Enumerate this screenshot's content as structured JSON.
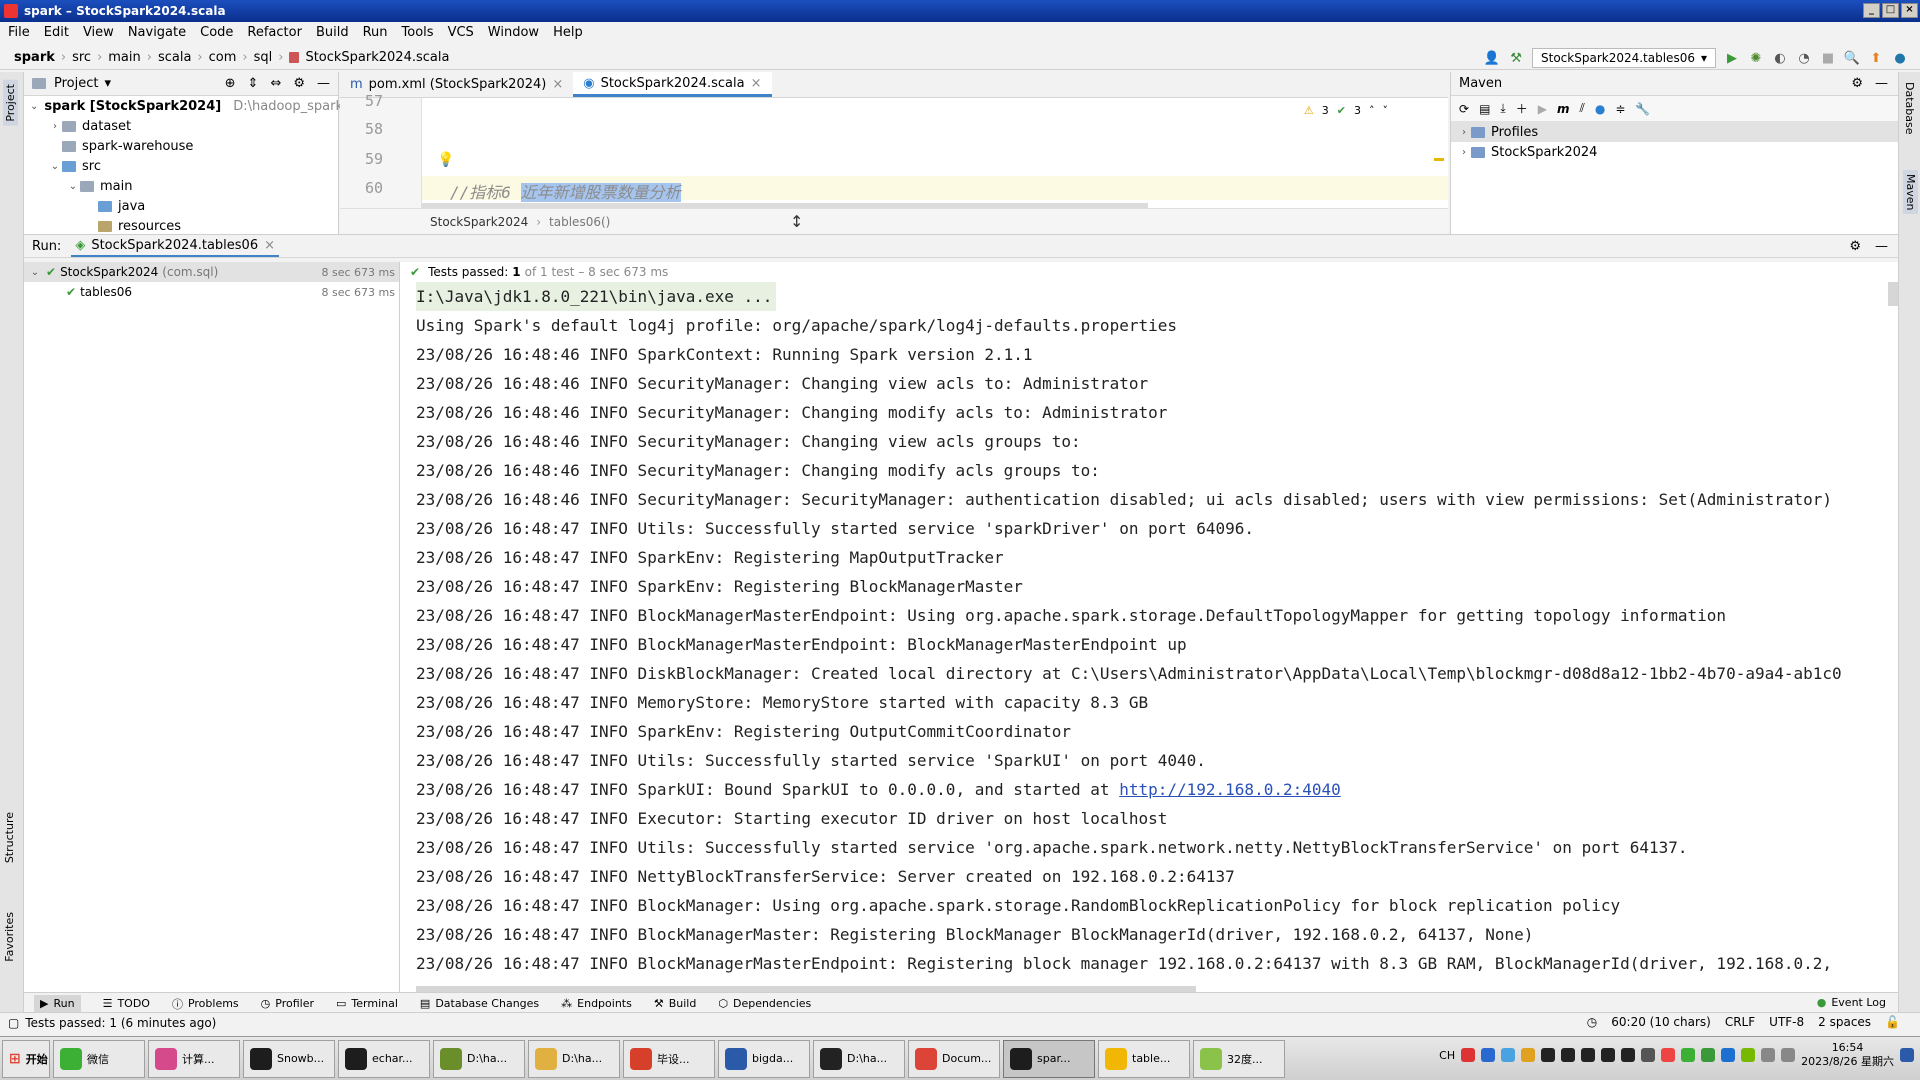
{
  "window": {
    "title": "spark – StockSpark2024.scala"
  },
  "menu": [
    "File",
    "Edit",
    "View",
    "Navigate",
    "Code",
    "Refactor",
    "Build",
    "Run",
    "Tools",
    "VCS",
    "Window",
    "Help"
  ],
  "breadcrumb": [
    "spark",
    "src",
    "main",
    "scala",
    "com",
    "sql",
    "StockSpark2024.scala"
  ],
  "run_config": "StockSpark2024.tables06",
  "project": {
    "header": "Project",
    "tree": [
      {
        "label": "spark [StockSpark2024]",
        "extra": "D:\\hadoop_spark",
        "indent": 0,
        "expanded": true
      },
      {
        "label": "dataset",
        "indent": 1,
        "expanded": false
      },
      {
        "label": "spark-warehouse",
        "indent": 1
      },
      {
        "label": "src",
        "indent": 1,
        "expanded": true
      },
      {
        "label": "main",
        "indent": 2,
        "expanded": true
      },
      {
        "label": "java",
        "indent": 3
      },
      {
        "label": "resources",
        "indent": 3
      }
    ]
  },
  "editor": {
    "tabs": [
      {
        "label": "pom.xml (StockSpark2024)",
        "active": false
      },
      {
        "label": "StockSpark2024.scala",
        "active": true
      }
    ],
    "lines": [
      "57",
      "58",
      "59",
      "60"
    ],
    "comment_prefix": "//指标6",
    "comment_selected": "近年新增股票数量分析",
    "warnings": "3",
    "checks": "3",
    "crumb_class": "StockSpark2024",
    "crumb_method": "tables06()"
  },
  "maven": {
    "title": "Maven",
    "items": [
      "Profiles",
      "StockSpark2024"
    ]
  },
  "run": {
    "label": "Run:",
    "tab": "StockSpark2024.tables06",
    "tree": [
      {
        "label": "StockSpark2024",
        "pkg": "(com.sql)",
        "time": "8 sec 673 ms"
      },
      {
        "label": "tables06",
        "pkg": "",
        "time": "8 sec 673 ms"
      }
    ],
    "status_prefix": "Tests passed:",
    "status_count": "1",
    "status_rest": "of 1 test – 8 sec 673 ms"
  },
  "console": {
    "cmd": "I:\\Java\\jdk1.8.0_221\\bin\\java.exe ...",
    "link_prefix": "23/08/26 16:48:47 INFO SparkUI: Bound SparkUI to 0.0.0.0, and started at ",
    "link": "http://192.168.0.2:4040",
    "lines_before_link": [
      "Using Spark's default log4j profile: org/apache/spark/log4j-defaults.properties",
      "23/08/26 16:48:46 INFO SparkContext: Running Spark version 2.1.1",
      "23/08/26 16:48:46 INFO SecurityManager: Changing view acls to: Administrator",
      "23/08/26 16:48:46 INFO SecurityManager: Changing modify acls to: Administrator",
      "23/08/26 16:48:46 INFO SecurityManager: Changing view acls groups to:",
      "23/08/26 16:48:46 INFO SecurityManager: Changing modify acls groups to:",
      "23/08/26 16:48:46 INFO SecurityManager: SecurityManager: authentication disabled; ui acls disabled; users  with view permissions: Set(Administrator)",
      "23/08/26 16:48:47 INFO Utils: Successfully started service 'sparkDriver' on port 64096.",
      "23/08/26 16:48:47 INFO SparkEnv: Registering MapOutputTracker",
      "23/08/26 16:48:47 INFO SparkEnv: Registering BlockManagerMaster",
      "23/08/26 16:48:47 INFO BlockManagerMasterEndpoint: Using org.apache.spark.storage.DefaultTopologyMapper for getting topology information",
      "23/08/26 16:48:47 INFO BlockManagerMasterEndpoint: BlockManagerMasterEndpoint up",
      "23/08/26 16:48:47 INFO DiskBlockManager: Created local directory at C:\\Users\\Administrator\\AppData\\Local\\Temp\\blockmgr-d08d8a12-1bb2-4b70-a9a4-ab1c0",
      "23/08/26 16:48:47 INFO MemoryStore: MemoryStore started with capacity 8.3 GB",
      "23/08/26 16:48:47 INFO SparkEnv: Registering OutputCommitCoordinator",
      "23/08/26 16:48:47 INFO Utils: Successfully started service 'SparkUI' on port 4040."
    ],
    "lines_after_link": [
      "23/08/26 16:48:47 INFO Executor: Starting executor ID driver on host localhost",
      "23/08/26 16:48:47 INFO Utils: Successfully started service 'org.apache.spark.network.netty.NettyBlockTransferService' on port 64137.",
      "23/08/26 16:48:47 INFO NettyBlockTransferService: Server created on 192.168.0.2:64137",
      "23/08/26 16:48:47 INFO BlockManager: Using org.apache.spark.storage.RandomBlockReplicationPolicy for block replication policy",
      "23/08/26 16:48:47 INFO BlockManagerMaster: Registering BlockManager BlockManagerId(driver, 192.168.0.2, 64137, None)",
      "23/08/26 16:48:47 INFO BlockManagerMasterEndpoint: Registering block manager 192.168.0.2:64137 with 8.3 GB RAM, BlockManagerId(driver, 192.168.0.2,"
    ]
  },
  "bottom_tabs": [
    "Run",
    "TODO",
    "Problems",
    "Profiler",
    "Terminal",
    "Database Changes",
    "Endpoints",
    "Build",
    "Dependencies"
  ],
  "event_log": "Event Log",
  "side_labels": {
    "project": "Project",
    "structure": "Structure",
    "favorites": "Favorites",
    "database": "Database",
    "maven": "Maven"
  },
  "status": {
    "message": "Tests passed: 1 (6 minutes ago)",
    "position": "60:20 (10 chars)",
    "line_sep": "CRLF",
    "encoding": "UTF-8",
    "indent": "2 spaces"
  },
  "taskbar": {
    "start": "开始",
    "items": [
      {
        "label": "微信",
        "color": "#3cb034"
      },
      {
        "label": "计算...",
        "color": "#d44a8a"
      },
      {
        "label": "Snowb...",
        "color": "#1d1d1d"
      },
      {
        "label": "echar...",
        "color": "#1d1d1d"
      },
      {
        "label": "D:\\ha...",
        "color": "#6a8f2a"
      },
      {
        "label": "D:\\ha...",
        "color": "#e0b040"
      },
      {
        "label": "毕设...",
        "color": "#d6402a"
      },
      {
        "label": "bigda...",
        "color": "#2a5aa8"
      },
      {
        "label": "D:\\ha...",
        "color": "#222"
      },
      {
        "label": "Docum...",
        "color": "#db4437"
      },
      {
        "label": "spar...",
        "color": "#1d1d1d",
        "active": true
      },
      {
        "label": "table...",
        "color": "#f2b705"
      },
      {
        "label": "32度...",
        "color": "#8bc34a"
      }
    ],
    "lang": "CH",
    "time": "16:54",
    "date": "2023/8/26 星期六"
  }
}
